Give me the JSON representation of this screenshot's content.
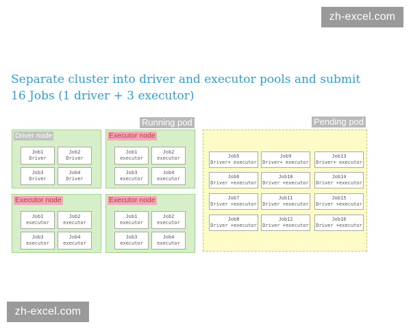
{
  "watermark": {
    "top": "zh-excel.com",
    "bottom": "zh-excel.com"
  },
  "title": "Separate cluster into driver and executor pools and submit\n16 Jobs (1 driver + 3 executor)",
  "labels": {
    "running": "Running pod",
    "pending": "Pending pod"
  },
  "running_nodes": [
    {
      "label": "Driver node",
      "jobs": [
        {
          "name": "Job1",
          "role": "Driver"
        },
        {
          "name": "Job2",
          "role": "Driver"
        },
        {
          "name": "Job3",
          "role": "Driver"
        },
        {
          "name": "Job4",
          "role": "Driver"
        }
      ]
    },
    {
      "label": "Executor node",
      "jobs": [
        {
          "name": "Job1",
          "role": "executor"
        },
        {
          "name": "Job2",
          "role": "executor"
        },
        {
          "name": "Job3",
          "role": "executor"
        },
        {
          "name": "Job4",
          "role": "executor"
        }
      ]
    },
    {
      "label": "Executor node",
      "jobs": [
        {
          "name": "Job1",
          "role": "executor"
        },
        {
          "name": "Job2",
          "role": "executor"
        },
        {
          "name": "Job3",
          "role": "executor"
        },
        {
          "name": "Job4",
          "role": "executor"
        }
      ]
    },
    {
      "label": "Executor node",
      "jobs": [
        {
          "name": "Job1",
          "role": "executor"
        },
        {
          "name": "Job2",
          "role": "executor"
        },
        {
          "name": "Job3",
          "role": "executor"
        },
        {
          "name": "Job4",
          "role": "executor"
        }
      ]
    }
  ],
  "pending_jobs": [
    {
      "name": "Job5",
      "role": "Driver+ executor"
    },
    {
      "name": "Job9",
      "role": "Driver+ executor"
    },
    {
      "name": "Job13",
      "role": "Driver+ executor"
    },
    {
      "name": "Job6",
      "role": "Driver +executor"
    },
    {
      "name": "Job10",
      "role": "Driver +executor"
    },
    {
      "name": "Job14",
      "role": "Driver +executor"
    },
    {
      "name": "Job7",
      "role": "Driver +executor"
    },
    {
      "name": "Job11",
      "role": "Driver +executor"
    },
    {
      "name": "Job15",
      "role": "Driver +executor"
    },
    {
      "name": "Job8",
      "role": "Driver +executor"
    },
    {
      "name": "Job12",
      "role": "Driver +executor"
    },
    {
      "name": "Job16",
      "role": "Driver +executor"
    }
  ]
}
